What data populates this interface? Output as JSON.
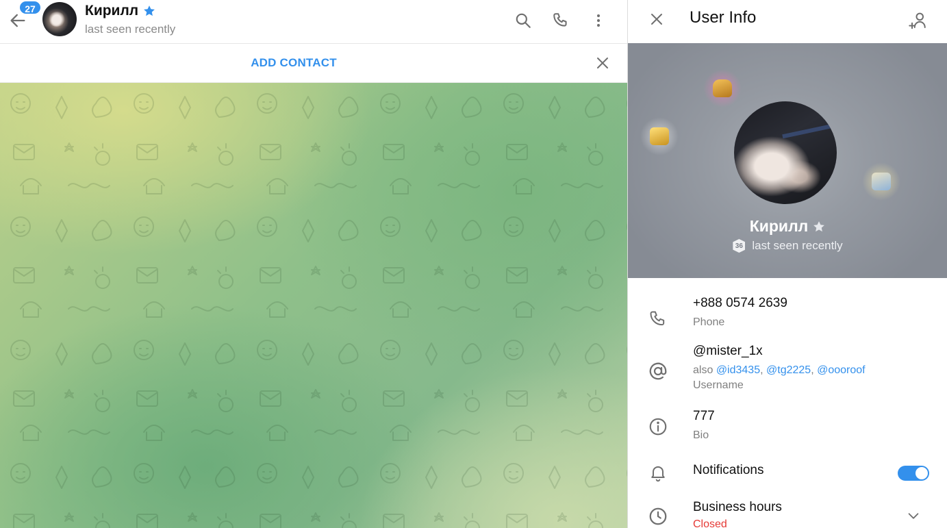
{
  "chat_header": {
    "unread_count": "27",
    "peer_name": "Кирилл",
    "peer_status": "last seen recently"
  },
  "add_contact_bar": {
    "label": "ADD CONTACT"
  },
  "user_info": {
    "title": "User Info",
    "profile": {
      "name": "Кирилл",
      "level": "36",
      "status": "last seen recently"
    },
    "phone": {
      "value": "+888 0574 2639",
      "label": "Phone"
    },
    "username": {
      "value": "@mister_1x",
      "also_prefix": "also",
      "also_usernames": [
        "@id3435",
        "@tg2225",
        "@oooroof"
      ],
      "label": "Username"
    },
    "bio": {
      "value": "777",
      "label": "Bio"
    },
    "notifications": {
      "label": "Notifications",
      "enabled": true
    },
    "business_hours": {
      "label": "Business hours",
      "status": "Closed"
    }
  },
  "colors": {
    "accent": "#3390ec",
    "closed": "#e53935",
    "banner": "#959aa2"
  },
  "icons": {
    "back": "arrow-left-icon",
    "search": "search-icon",
    "call": "phone-icon",
    "more": "more-vertical-icon",
    "close": "close-icon",
    "add_user": "add-user-icon",
    "verified_star": "star-icon",
    "phone": "phone-icon",
    "username": "at-sign-icon",
    "bio": "info-icon",
    "notifications": "bell-icon",
    "business_hours": "clock-icon",
    "expand": "chevron-down-icon"
  }
}
